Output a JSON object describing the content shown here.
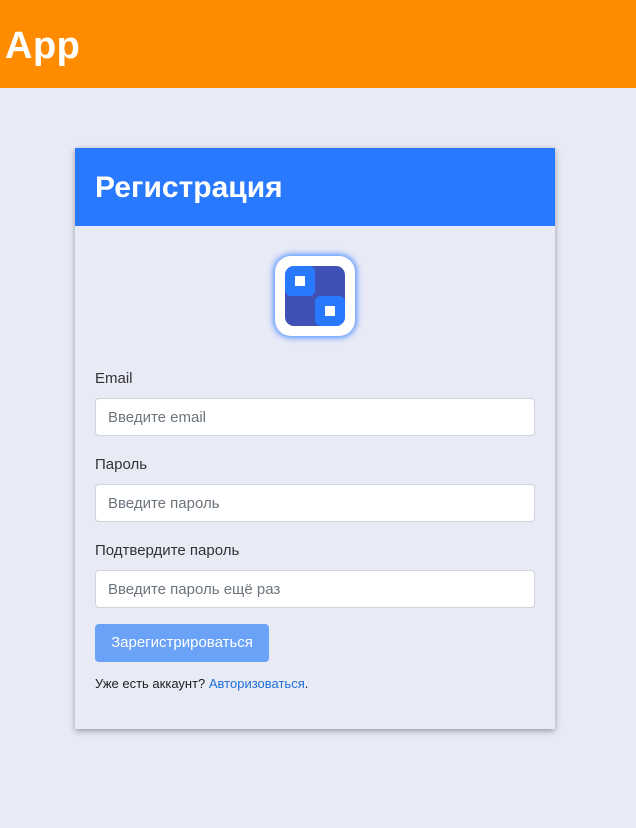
{
  "app": {
    "title": "App"
  },
  "colors": {
    "header_bg": "#ff8c00",
    "page_bg": "#e8eaf6",
    "card_header_bg": "#2979ff",
    "button_bg": "#6aa2f7",
    "link": "#1e6fd9",
    "logo_primary": "#3f51b5",
    "logo_accent": "#2979ff"
  },
  "card": {
    "title": "Регистрация",
    "logo_icon": "app-logo-icon"
  },
  "form": {
    "email": {
      "label": "Email",
      "placeholder": "Введите email",
      "value": ""
    },
    "password": {
      "label": "Пароль",
      "placeholder": "Введите пароль",
      "value": ""
    },
    "confirm_password": {
      "label": "Подтвердите пароль",
      "placeholder": "Введите пароль ещё раз",
      "value": ""
    },
    "submit_label": "Зарегистрироваться"
  },
  "login_prompt": {
    "text": "Уже есть аккаунт? ",
    "link_text": "Авторизоваться",
    "suffix": "."
  }
}
